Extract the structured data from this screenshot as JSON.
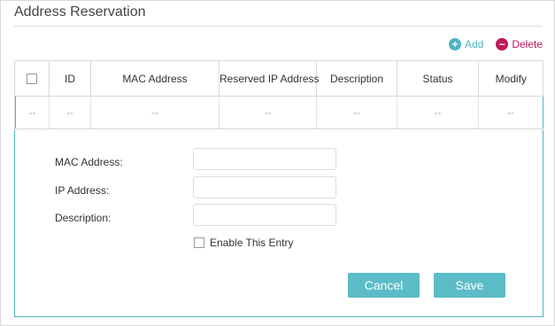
{
  "section": {
    "title": "Address Reservation"
  },
  "toolbar": {
    "add_label": "Add",
    "add_icon": "plus-circle-icon",
    "delete_label": "Delete",
    "delete_icon": "minus-circle-icon"
  },
  "table": {
    "headers": [
      "ID",
      "MAC Address",
      "Reserved IP Address",
      "Description",
      "Status",
      "Modify"
    ],
    "rows": [
      [
        "--",
        "--",
        "--",
        "--",
        "--",
        "--",
        "--"
      ]
    ]
  },
  "form": {
    "mac_label": "MAC Address:",
    "ip_label": "IP Address:",
    "description_label": "Description:",
    "mac_value": "",
    "ip_value": "",
    "description_value": "",
    "enable_label": "Enable This Entry",
    "enable_checked": false,
    "cancel_label": "Cancel",
    "save_label": "Save"
  },
  "colors": {
    "accent": "#4fb3c3",
    "button": "#5bbcc8",
    "delete": "#c2185b"
  }
}
